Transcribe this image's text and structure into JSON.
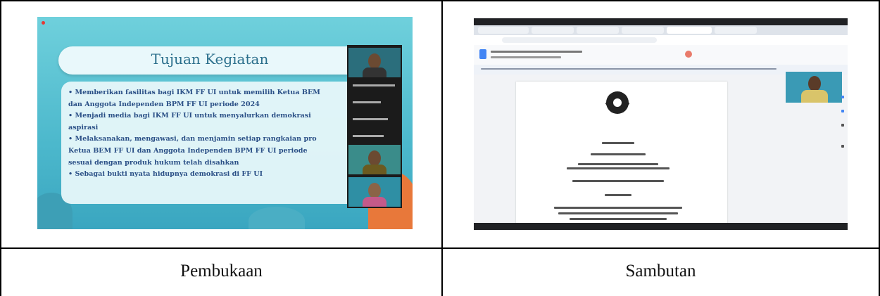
{
  "table": {
    "captions": [
      "Pembukaan",
      "Sambutan"
    ]
  },
  "left_screenshot": {
    "title": "Tujuan Kegiatan",
    "bullets": [
      "• Memberikan fasilitas bagi IKM FF UI untuk memilih Ketua BEM",
      "  dan Anggota Independen BPM FF UI periode 2024",
      "• Menjadi media bagi IKM FF UI untuk menyalurkan demokrasi",
      "  aspirasi",
      "• Melaksanakan, mengawasi, dan menjamin setiap rangkaian pro",
      "  Ketua BEM FF UI dan Anggota Independen BPM FF UI periode",
      "  sesuai dengan produk hukum telah disahkan",
      "• Sebagai bukti nyata hidupnya demokrasi di FF UI"
    ]
  },
  "colors": {
    "slide_bg": "#5fc4d4",
    "title_text": "#2b6f8c",
    "bullet_text": "#2a4f86",
    "coral_orange": "#e8783a"
  }
}
